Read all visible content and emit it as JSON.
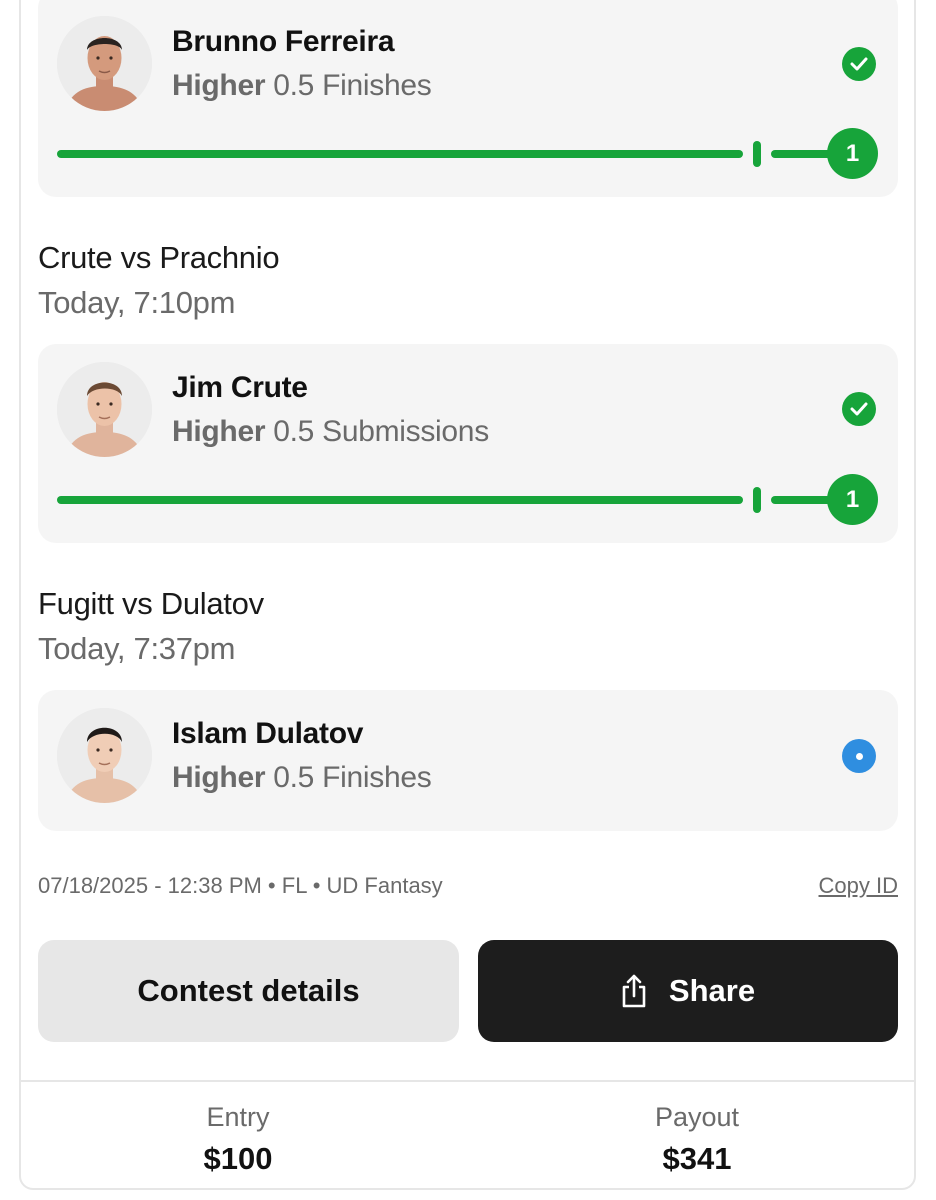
{
  "picks": [
    {
      "player": "Brunno Ferreira",
      "direction": "Higher",
      "line": "0.5",
      "stat": "Finishes",
      "status": "won",
      "progress_value": "1"
    },
    {
      "player": "Jim Crute",
      "direction": "Higher",
      "line": "0.5",
      "stat": "Submissions",
      "status": "won",
      "progress_value": "1"
    },
    {
      "player": "Islam Dulatov",
      "direction": "Higher",
      "line": "0.5",
      "stat": "Finishes",
      "status": "pending"
    }
  ],
  "matchups": [
    {
      "title": "Crute vs Prachnio",
      "time": "Today, 7:10pm"
    },
    {
      "title": "Fugitt vs Dulatov",
      "time": "Today, 7:37pm"
    }
  ],
  "meta": {
    "info": "07/18/2025 - 12:38 PM • FL • UD Fantasy",
    "copy_id": "Copy ID"
  },
  "buttons": {
    "contest_details": "Contest details",
    "share": "Share"
  },
  "footer": {
    "entry_label": "Entry",
    "entry_value": "$100",
    "payout_label": "Payout",
    "payout_value": "$341"
  },
  "colors": {
    "success": "#17a43a",
    "pending": "#2f8ee0",
    "dark_button": "#1d1d1d"
  },
  "icons": [
    "check-icon",
    "pending-dot-icon",
    "share-icon",
    "player-avatar"
  ]
}
